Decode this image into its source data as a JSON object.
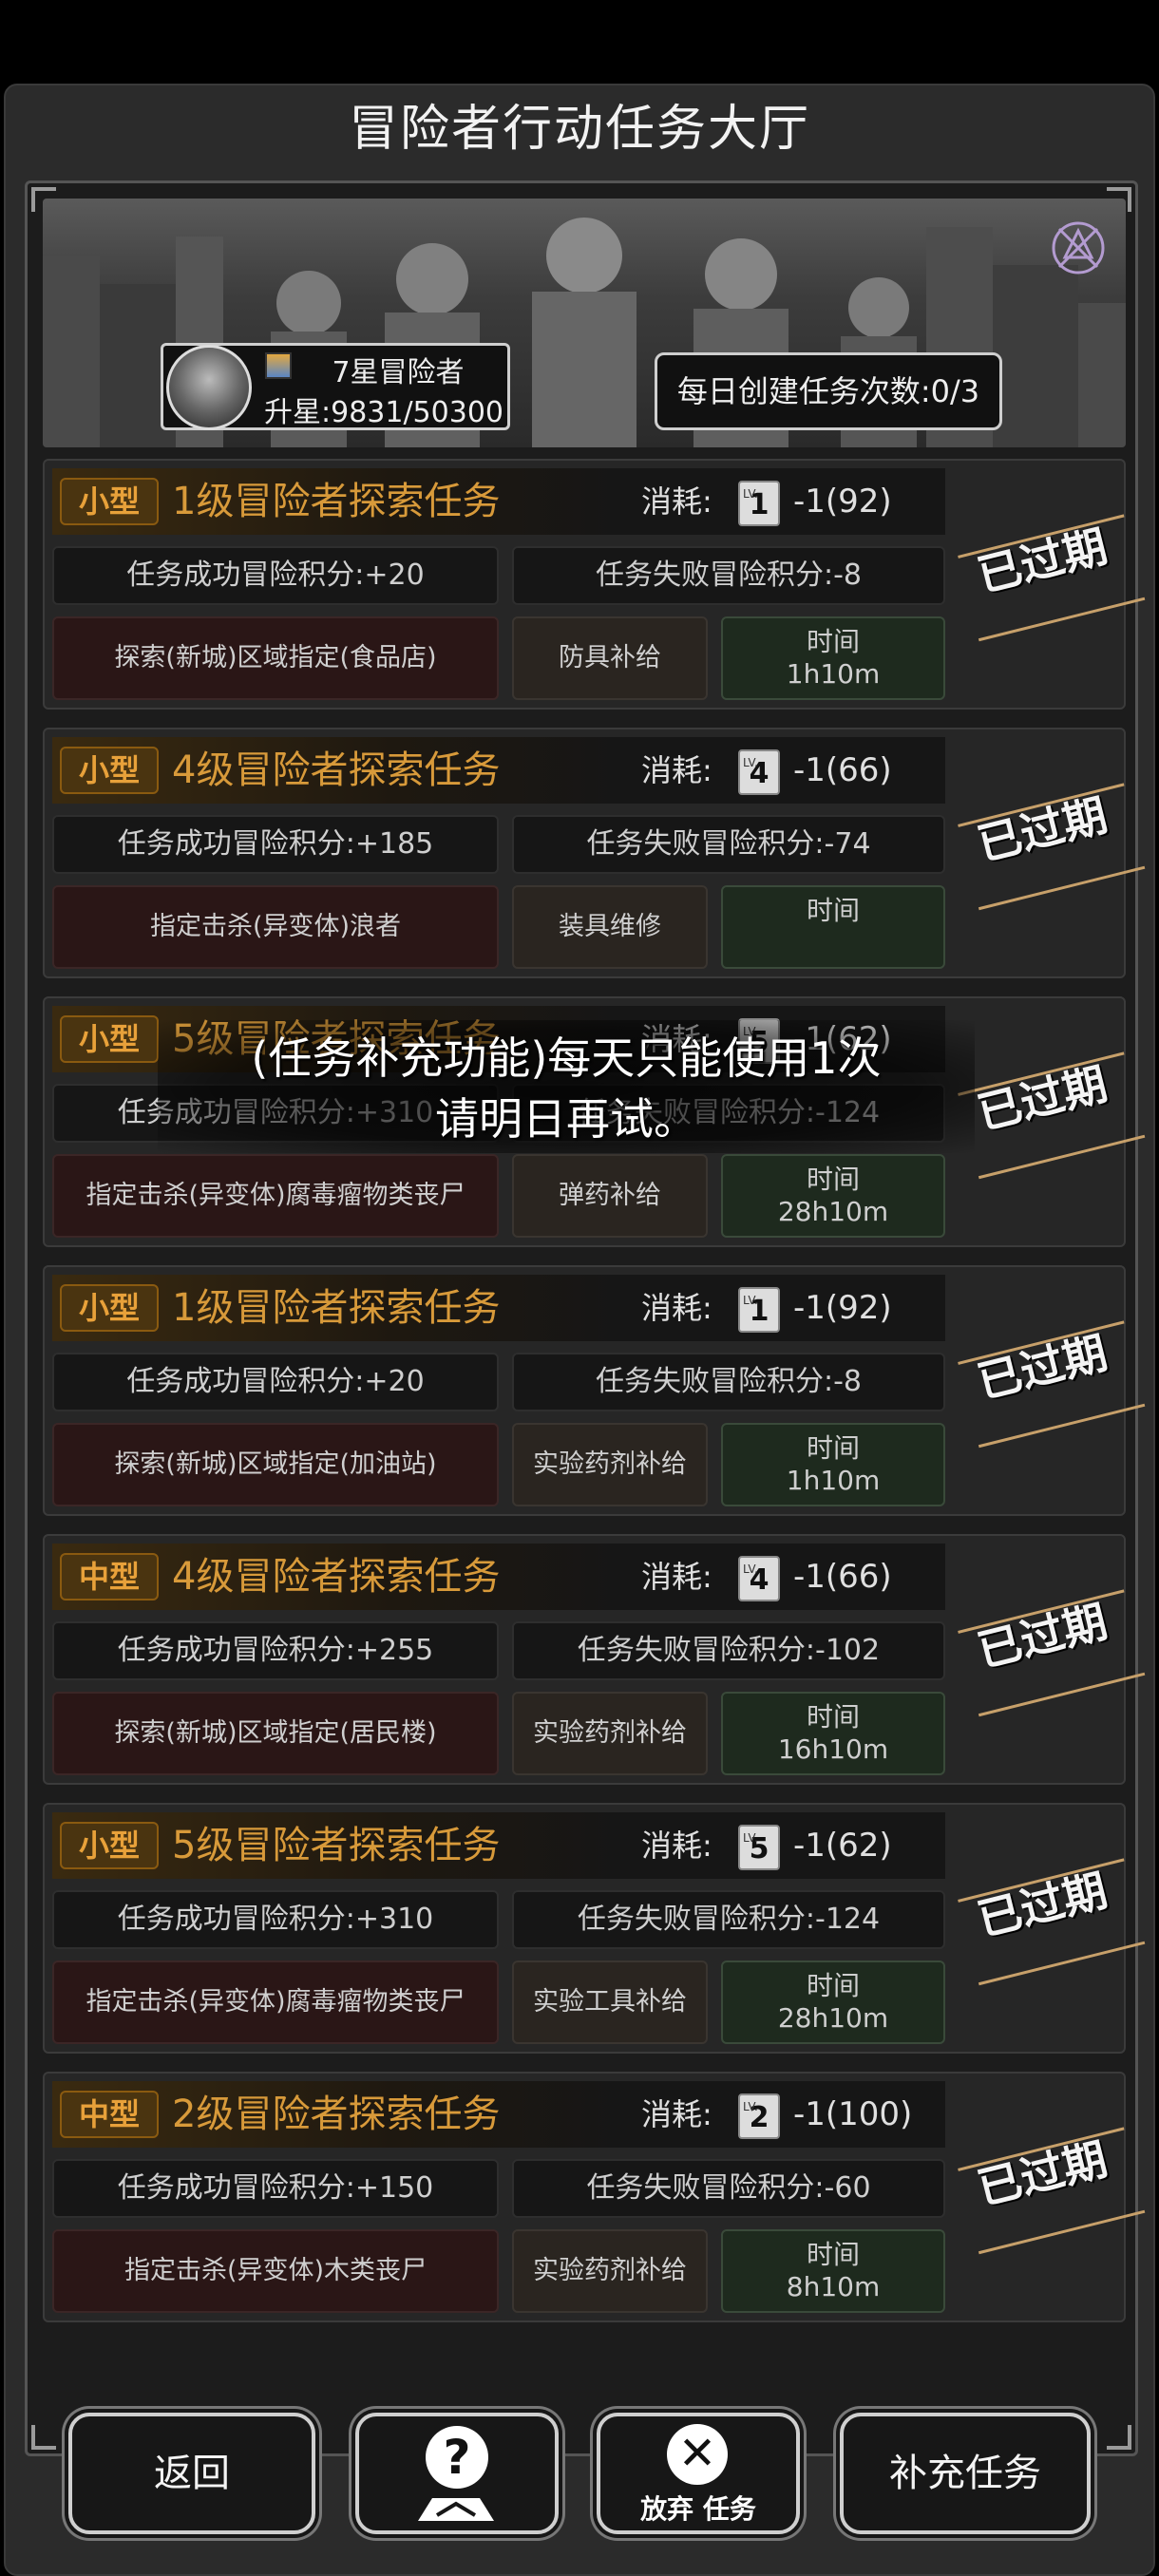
{
  "title": "冒险者行动任务大厅",
  "profile": {
    "rank_label": "7星冒险者",
    "rank_progress": "升星:9831/50300",
    "daily_create": "每日创建任务次数:0/3"
  },
  "cost_label": "消耗:",
  "expired_label": "已过期",
  "time_label": "时间",
  "tasks": [
    {
      "size": "小型",
      "title": "1级冒险者探索任务",
      "level": "1",
      "cost": "-1(92)",
      "success": "任务成功冒险积分:+20",
      "fail": "任务失败冒险积分:-8",
      "target": "探索(新城)区域指定(食品店)",
      "supply": "防具补给",
      "time": "1h10m"
    },
    {
      "size": "小型",
      "title": "4级冒险者探索任务",
      "level": "4",
      "cost": "-1(66)",
      "success": "任务成功冒险积分:+185",
      "fail": "任务失败冒险积分:-74",
      "target": "指定击杀(异变体)浪者",
      "supply": "装具维修",
      "time": ""
    },
    {
      "size": "小型",
      "title": "5级冒险者探索任务",
      "level": "5",
      "cost": "-1(62)",
      "success": "任务成功冒险积分:+310",
      "fail": "任务失败冒险积分:-124",
      "target": "指定击杀(异变体)腐毒瘤物类丧尸",
      "supply": "弹药补给",
      "time": "28h10m"
    },
    {
      "size": "小型",
      "title": "1级冒险者探索任务",
      "level": "1",
      "cost": "-1(92)",
      "success": "任务成功冒险积分:+20",
      "fail": "任务失败冒险积分:-8",
      "target": "探索(新城)区域指定(加油站)",
      "supply": "实验药剂补给",
      "time": "1h10m"
    },
    {
      "size": "中型",
      "title": "4级冒险者探索任务",
      "level": "4",
      "cost": "-1(66)",
      "success": "任务成功冒险积分:+255",
      "fail": "任务失败冒险积分:-102",
      "target": "探索(新城)区域指定(居民楼)",
      "supply": "实验药剂补给",
      "time": "16h10m"
    },
    {
      "size": "小型",
      "title": "5级冒险者探索任务",
      "level": "5",
      "cost": "-1(62)",
      "success": "任务成功冒险积分:+310",
      "fail": "任务失败冒险积分:-124",
      "target": "指定击杀(异变体)腐毒瘤物类丧尸",
      "supply": "实验工具补给",
      "time": "28h10m"
    },
    {
      "size": "中型",
      "title": "2级冒险者探索任务",
      "level": "2",
      "cost": "-1(100)",
      "success": "任务成功冒险积分:+150",
      "fail": "任务失败冒险积分:-60",
      "target": "指定击杀(异变体)木类丧尸",
      "supply": "实验药剂补给",
      "time": "8h10m"
    }
  ],
  "toast": {
    "line1": "(任务补充功能)每天只能使用1次",
    "line2": "请明日再试。"
  },
  "buttons": {
    "back": "返回",
    "help_icon": "question-icon",
    "abandon": "放弃 任务",
    "supplement": "补充任务"
  }
}
